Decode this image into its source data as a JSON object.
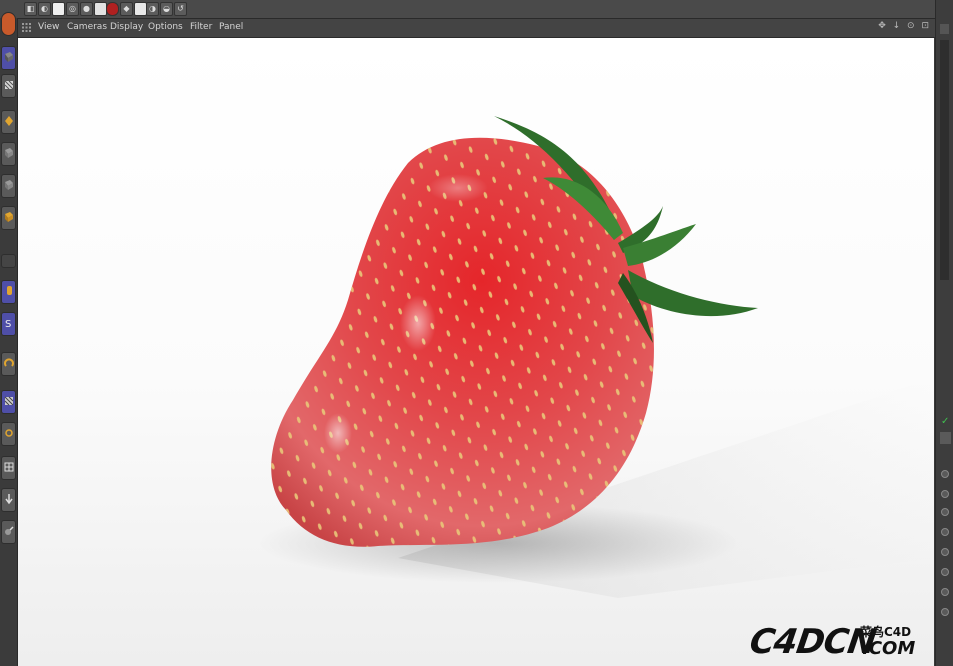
{
  "viewport_menu": {
    "items": [
      "View",
      "Cameras",
      "Display",
      "Options",
      "Filter",
      "Panel"
    ],
    "controls": "✥ ↓ ⊙ ⊡"
  },
  "watermark": {
    "logo": "C4DCN",
    "chinese": "菜鸟C4D",
    "domain": ".COM"
  },
  "scene": {
    "object": "strawberry",
    "fruit_color": "#d92f30",
    "leaf_color": "#2e6b2a",
    "seed_color": "#e8c46a"
  },
  "icons": {
    "top_toolbar": [
      "render-region-icon",
      "render-view-icon",
      "render-settings-icon",
      "object-icon",
      "material-icon",
      "light-icon",
      "sphere-icon",
      "cube-icon",
      "camera-icon",
      "environment-icon",
      "deformer-icon",
      "spline-icon",
      "generator-icon"
    ],
    "left_palette": [
      "model-mode-icon",
      "point-mode-icon",
      "edge-mode-icon",
      "polygon-mode-icon",
      "texture-mode-icon",
      "axis-mode-icon",
      "workplane-icon",
      "move-tool-icon",
      "snap-icon",
      "magnet-icon",
      "brush-icon",
      "grid-icon",
      "arrow-down-icon",
      "sculpt-icon"
    ]
  }
}
